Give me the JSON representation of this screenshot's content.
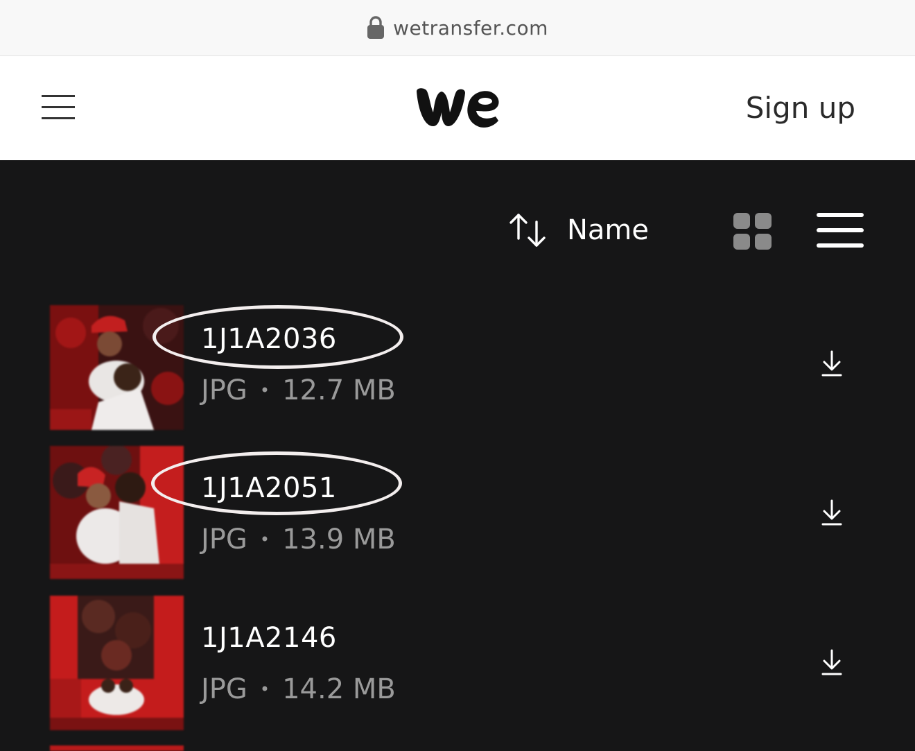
{
  "browser": {
    "url": "wetransfer.com",
    "lock_icon": "lock-icon"
  },
  "header": {
    "menu_icon": "hamburger-menu-icon",
    "logo": "we",
    "signup_label": "Sign up"
  },
  "toolbar": {
    "sort_icon": "sort-arrows-icon",
    "sort_label": "Name",
    "grid_view_icon": "grid-view-icon",
    "list_view_icon": "list-view-icon"
  },
  "files": [
    {
      "name": "1J1A2036",
      "type": "JPG",
      "size": "12.7 MB",
      "highlighted": true
    },
    {
      "name": "1J1A2051",
      "type": "JPG",
      "size": "13.9 MB",
      "highlighted": true
    },
    {
      "name": "1J1A2146",
      "type": "JPG",
      "size": "14.2 MB",
      "highlighted": false
    }
  ],
  "meta_separator": "•",
  "colors": {
    "panel_bg": "#161617",
    "name_text": "#ffffff",
    "meta_text": "#9a9a9a",
    "highlight_ring": "#f3eeee",
    "thumb_red": "#b01a1a"
  }
}
